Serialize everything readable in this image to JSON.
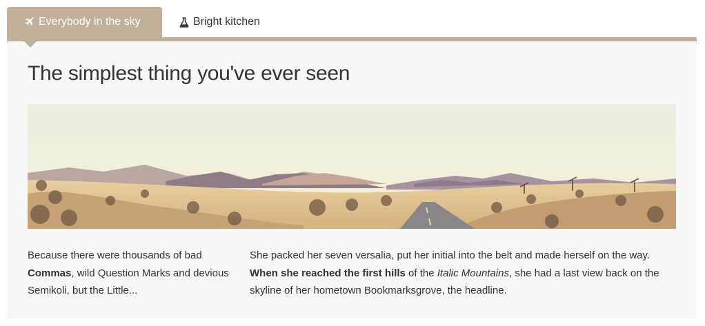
{
  "tabs": [
    {
      "label": "Everybody in the sky",
      "icon": "airplane-icon",
      "active": true
    },
    {
      "label": "Bright kitchen",
      "icon": "flask-icon",
      "active": false
    }
  ],
  "panel": {
    "title": "The simplest thing you've ever seen",
    "image": "desert-road-landscape",
    "left_text": {
      "part1": "Because there were thousands of bad ",
      "bold": "Commas",
      "part2": ", wild Question Marks and devious Semikoli, but the Little..."
    },
    "right_text": {
      "part1": "She packed her seven versalia, put her initial into the belt and made herself on the way. ",
      "bold": "When she reached the first hills",
      "part2": " of the ",
      "italic": "Italic Mountains",
      "part3": ", she had a last view back on the skyline of her hometown Bookmarksgrove, the headline."
    }
  },
  "colors": {
    "accent": "#c2b09b",
    "panel_bg": "#f7f7f7",
    "text": "#333333"
  }
}
